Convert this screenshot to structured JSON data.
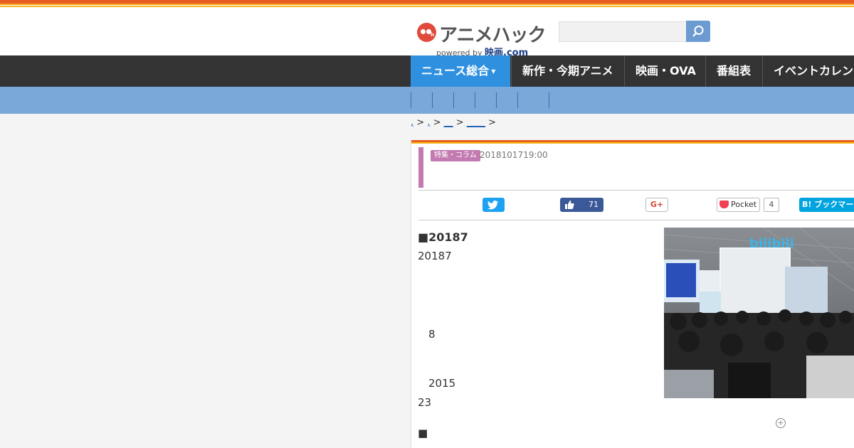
{
  "header": {
    "logo_text": "アニメハック",
    "logo_sub_prefix": "powered by",
    "logo_sub_brand": "映画.com",
    "search_placeholder": ""
  },
  "nav": {
    "items": [
      {
        "label": "ニュース総合",
        "active": true
      },
      {
        "label": "新作・今期アニメ"
      },
      {
        "label": "映画・OVA"
      },
      {
        "label": "番組表"
      },
      {
        "label": "イベントカレンダー"
      }
    ]
  },
  "breadcrumb": {
    "sep": ">",
    "items": [
      ",",
      ",",
      "__",
      "____"
    ]
  },
  "article": {
    "category_badge": "特集・コラム",
    "date": "2018101719:00",
    "share": {
      "facebook_count": "71",
      "google_label": "G+",
      "pocket_label": "Pocket",
      "pocket_count": "4",
      "hatena_label": "B! ブックマーク"
    },
    "lines": [
      "■20187",
      "20187",
      "8",
      "2015",
      "23",
      "■"
    ],
    "photo_sign": "bilibili"
  },
  "colors": {
    "accent": "#2f90e0",
    "nav_bg": "#333333",
    "subnav_bg": "#7aa9d9",
    "badge": "#c27ab0"
  }
}
